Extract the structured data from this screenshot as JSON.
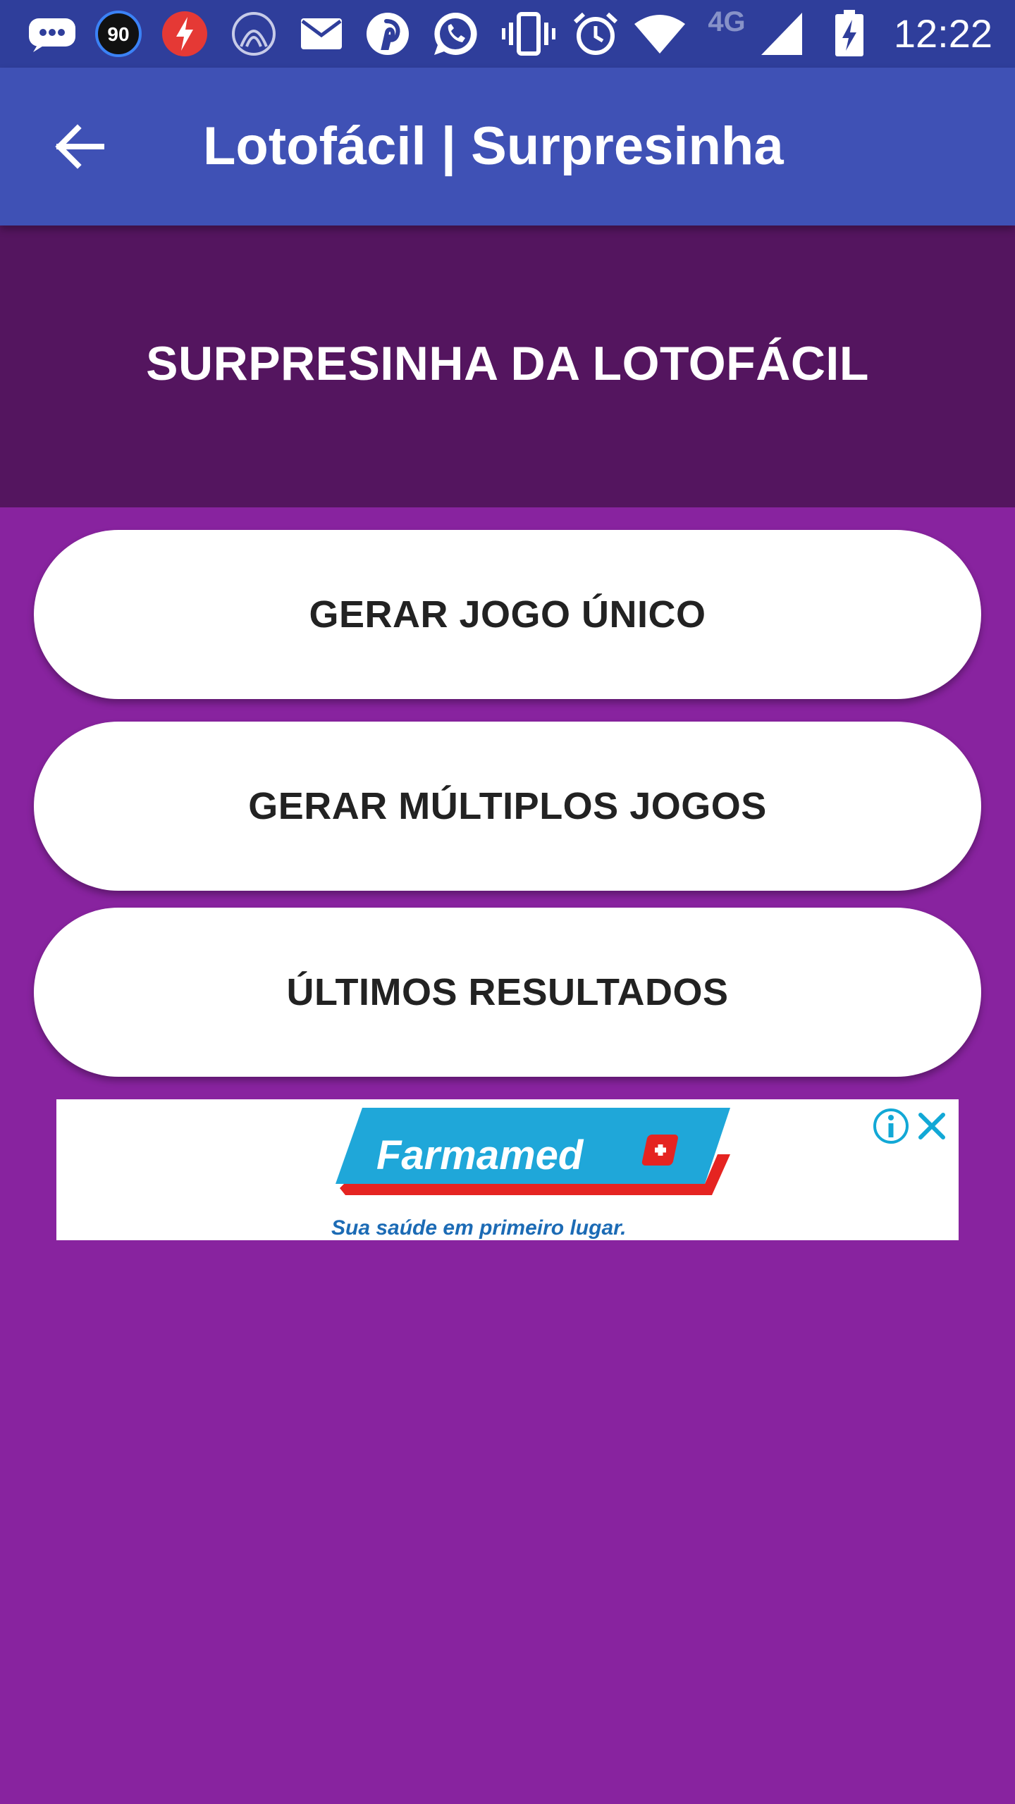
{
  "status_bar": {
    "time": "12:22",
    "badge_number": "90",
    "network_type": "4G",
    "icons": [
      "messages-icon",
      "badge-90-icon",
      "flash-app-icon",
      "arc-app-icon",
      "mail-icon",
      "pinterest-icon",
      "whatsapp-icon",
      "vibrate-icon",
      "alarm-icon",
      "wifi-icon",
      "cell-signal-icon",
      "battery-charging-icon"
    ]
  },
  "app_bar": {
    "title": "Lotofácil | Surpresinha",
    "back_icon": "arrow-back-icon"
  },
  "banner": {
    "title": "SURPRESINHA DA LOTOFÁCIL"
  },
  "buttons": {
    "single_game": "GERAR JOGO ÚNICO",
    "multiple_games": "GERAR MÚLTIPLOS JOGOS",
    "latest_results": "ÚLTIMOS RESULTADOS"
  },
  "ad": {
    "brand": "Farmamed",
    "tagline": "Sua saúde em primeiro lugar.",
    "info_icon": "info-icon",
    "close_icon": "close-icon"
  },
  "colors": {
    "status_bar": "#2f3e9b",
    "app_bar": "#3f51b5",
    "banner": "#54155f",
    "background": "#88239f",
    "button": "#ffffff",
    "ad_accent": "#1fa7d9",
    "ad_red": "#e52421"
  }
}
